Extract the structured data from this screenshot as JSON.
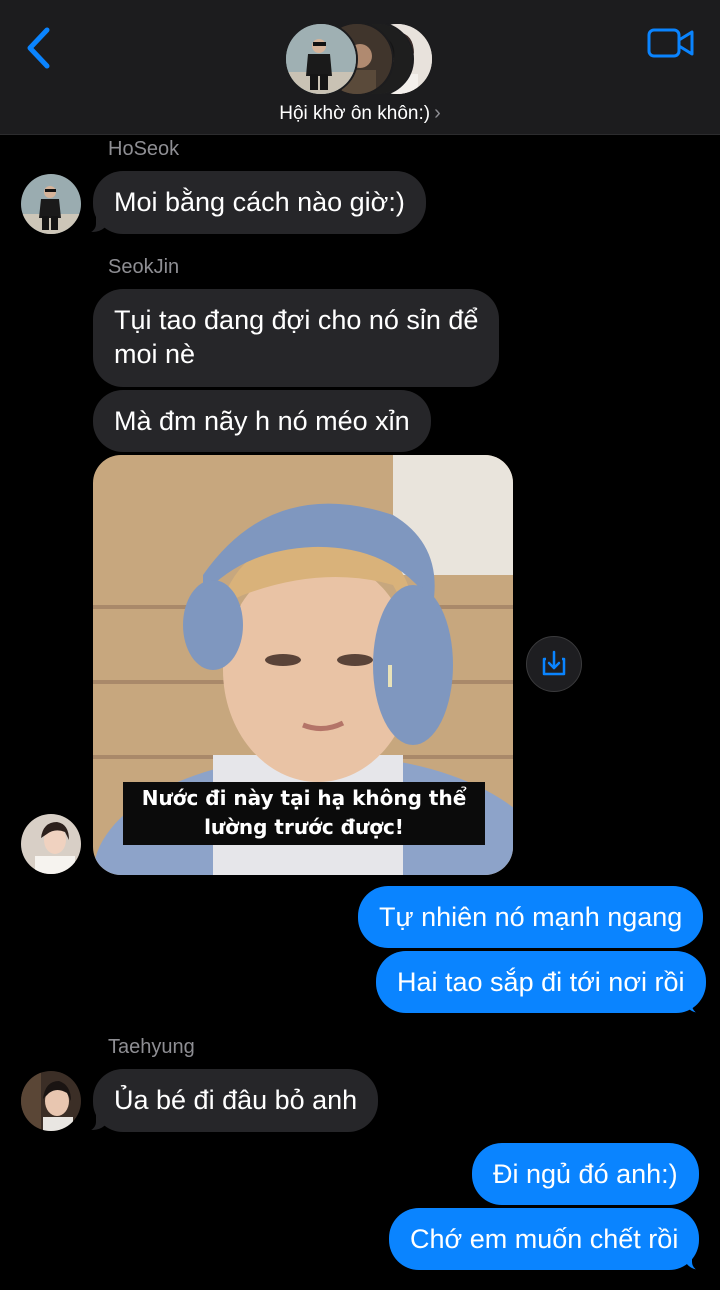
{
  "header": {
    "back_icon": "chevron-left-icon",
    "video_icon": "video-camera-icon",
    "group_name": "Hội khờ ôn khôn:)",
    "chevron": "›",
    "accent_color": "#0a84ff"
  },
  "messages": {
    "hoseok": {
      "sender": "HoSeok",
      "text1": "Moi bằng cách nào giờ:)"
    },
    "seokjin": {
      "sender": "SeokJin",
      "text1_line1": "Tụi tao đang đợi cho nó sỉn để",
      "text1_line2": "moi nè",
      "text2": "Mà đm nãy h nó méo xỉn",
      "image_caption_line1": "Nước đi này tại hạ không thể",
      "image_caption_line2": "lường trước được!"
    },
    "me1": {
      "text1": "Tự nhiên nó mạnh ngang",
      "text2": "Hai tao sắp đi tới nơi rồi"
    },
    "taehyung": {
      "sender": "Taehyung",
      "text1": "Ủa bé đi đâu bỏ anh"
    },
    "me2": {
      "text1": "Đi ngủ đó anh:)",
      "text2": "Chớ em muốn chết rồi"
    }
  },
  "colors": {
    "incoming_bubble": "#262629",
    "outgoing_bubble": "#0a84ff",
    "sender_name": "#8e8e93"
  },
  "save_icon": "save-share-icon"
}
